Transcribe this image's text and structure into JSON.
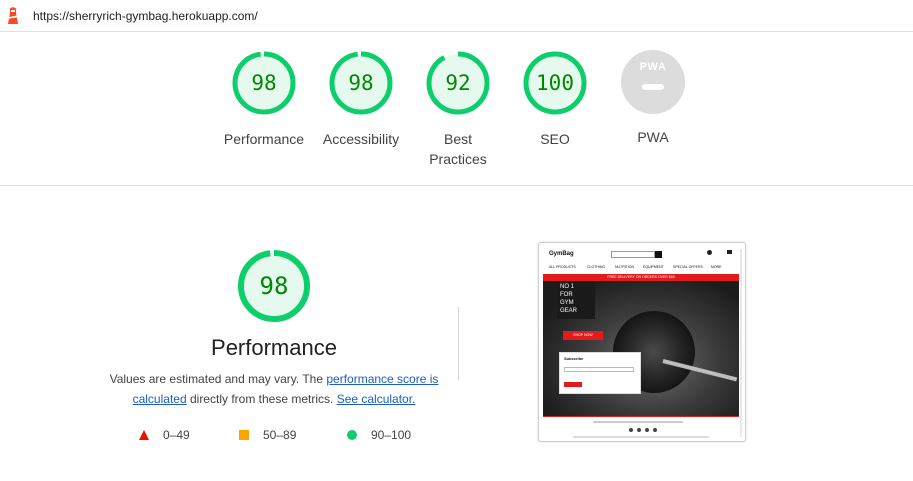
{
  "url_bar": {
    "logo_icon": "lighthouse-icon",
    "url": "https://sherryrich-gymbag.herokuapp.com/"
  },
  "categories": [
    {
      "label": "Performance",
      "score": 98
    },
    {
      "label": "Accessibility",
      "score": 98
    },
    {
      "label": "Best Practices",
      "score": 92
    },
    {
      "label": "SEO",
      "score": 100
    }
  ],
  "pwa": {
    "badge_text": "PWA",
    "label": "PWA"
  },
  "performance": {
    "score": 98,
    "title": "Performance",
    "desc_prefix": "Values are estimated and may vary. The ",
    "link_score": "performance score is calculated",
    "desc_middle": " directly from these metrics. ",
    "link_calculator": "See calculator."
  },
  "legend": {
    "fail": "0–49",
    "average": "50–89",
    "pass": "90–100"
  },
  "colors": {
    "pass": "#0cce6b",
    "pass_text": "#008800",
    "average": "#ffa400",
    "fail": "#eb0f00",
    "link": "#1a5dc8"
  },
  "screenshot": {
    "logo": "GymBag",
    "nav": [
      "ALL PRODUCTS",
      "CLOTHING",
      "NUTRITION",
      "EQUIPMENT",
      "SPECIAL OFFERS",
      "MORE"
    ],
    "banner": "FREE DELIVERY ON ORDERS OVER $60",
    "hero_text": "NO 1\nFOR\nGYM\nGEAR",
    "shop_button": "SHOP NOW",
    "subscribe_title": "Subscribe"
  }
}
